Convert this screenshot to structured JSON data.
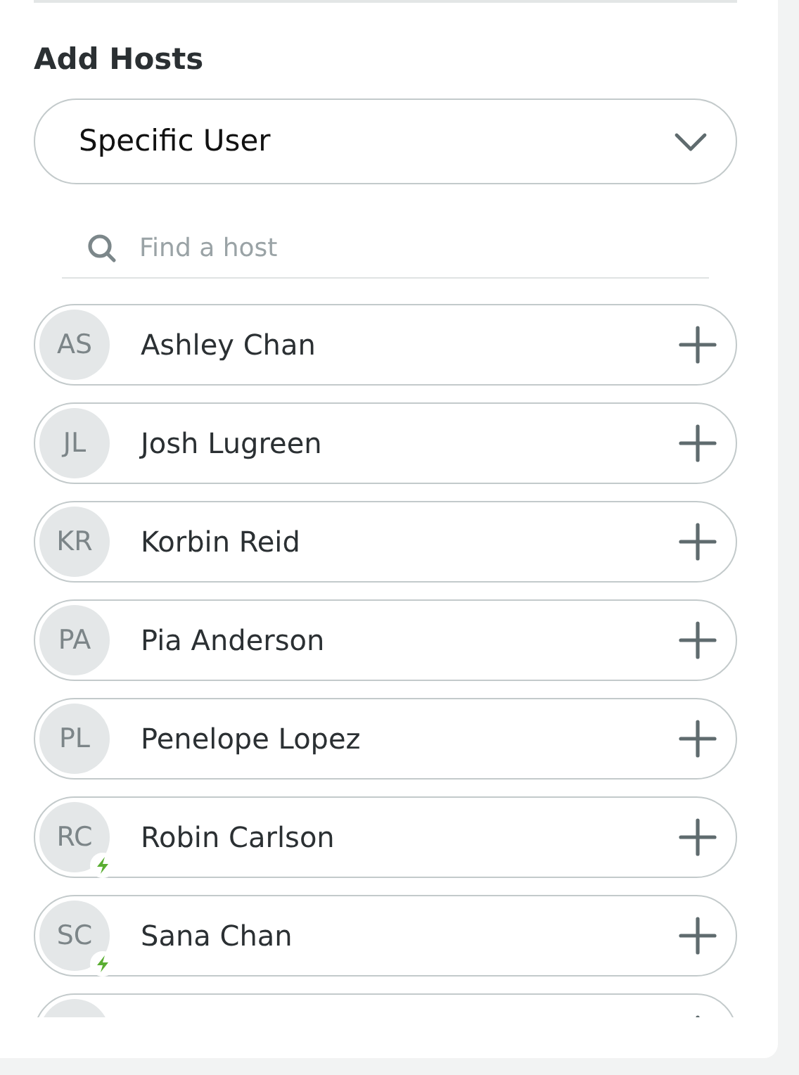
{
  "section_title": "Add Hosts",
  "host_type": {
    "value": "Specific User"
  },
  "search": {
    "placeholder": "Find a host"
  },
  "hosts": [
    {
      "initials": "AS",
      "name": "Ashley Chan",
      "boosted": false
    },
    {
      "initials": "JL",
      "name": "Josh Lugreen",
      "boosted": false
    },
    {
      "initials": "KR",
      "name": "Korbin Reid",
      "boosted": false
    },
    {
      "initials": "PA",
      "name": "Pia Anderson",
      "boosted": false
    },
    {
      "initials": "PL",
      "name": "Penelope Lopez",
      "boosted": false
    },
    {
      "initials": "RC",
      "name": "Robin Carlson",
      "boosted": true
    },
    {
      "initials": "SC",
      "name": "Sana Chan",
      "boosted": true
    },
    {
      "boosted": false
    }
  ]
}
